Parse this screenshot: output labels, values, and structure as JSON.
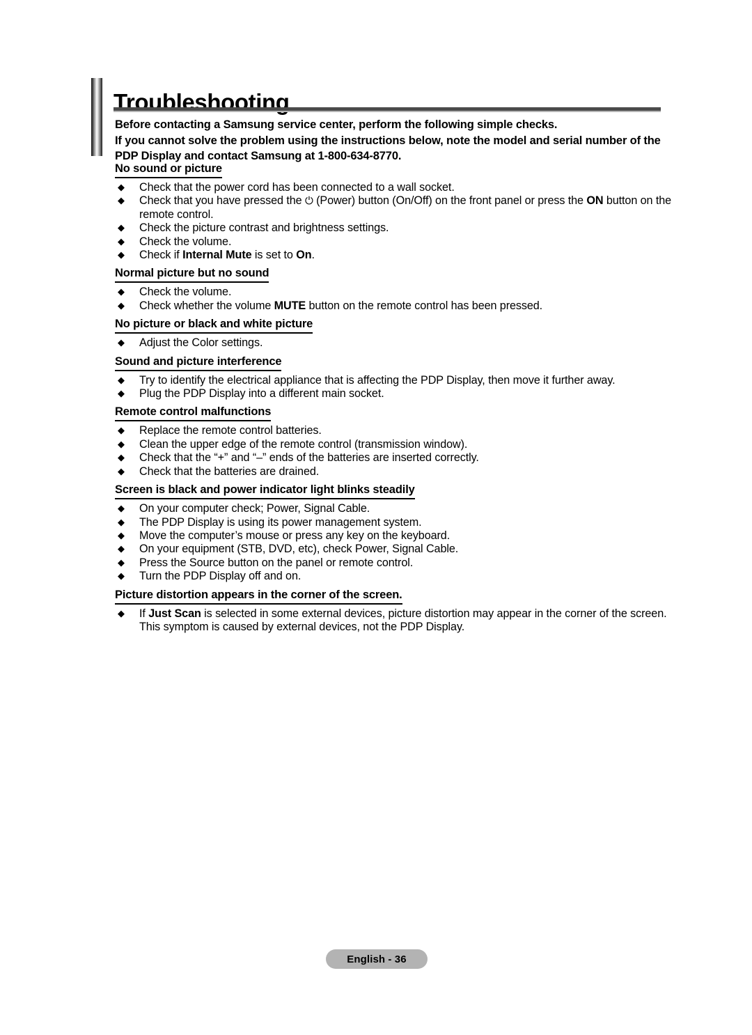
{
  "document": {
    "title": "Troubleshooting",
    "intro_lines": [
      "Before contacting a Samsung service center, perform the following simple checks.",
      "If you cannot solve the problem using the instructions below, note the model and serial number of the PDP Display and contact Samsung at 1-800-634-8770."
    ],
    "intro_full": "Before contacting a Samsung service center, perform the following simple checks. If you cannot solve the problem using the instructions below, note the model and serial number of the PDP Display and contact Samsung at 1-800-634-8770.",
    "bullet_glyph": "◆",
    "power_glyph": "⏻",
    "sections": [
      {
        "heading": "No sound or picture",
        "bullets": [
          {
            "text": "Check that the power cord has been connected to a wall socket."
          },
          {
            "text": "Check that you have pressed the ⏻ (Power) button (On/Off) on the front panel or press the ON button on the remote control.",
            "bold_parts": [
              "ON"
            ]
          },
          {
            "text": "Check the picture contrast and brightness settings."
          },
          {
            "text": "Check the volume."
          },
          {
            "text": "Check if Internal Mute is set to On.",
            "bold_parts": [
              "Internal Mute",
              "On"
            ]
          }
        ]
      },
      {
        "heading": "Normal picture but no sound",
        "bullets": [
          {
            "text": "Check the volume."
          },
          {
            "text": "Check whether the volume MUTE button on the remote control has been pressed.",
            "bold_parts": [
              "MUTE"
            ]
          }
        ]
      },
      {
        "heading": "No picture or black and white picture",
        "bullets": [
          {
            "text": "Adjust the Color settings."
          }
        ]
      },
      {
        "heading": "Sound and picture interference",
        "bullets": [
          {
            "text": "Try to identify the electrical appliance that is affecting the PDP Display, then move it further away."
          },
          {
            "text": "Plug the PDP Display into a different main socket."
          }
        ]
      },
      {
        "heading": "Remote control malfunctions",
        "bullets": [
          {
            "text": "Replace the remote control batteries."
          },
          {
            "text": "Clean the upper edge of the remote control (transmission window)."
          },
          {
            "text": "Check that the “+” and “–” ends of the batteries are inserted correctly."
          },
          {
            "text": "Check that the batteries are drained."
          }
        ]
      },
      {
        "heading": "Screen is black and power indicator light blinks steadily",
        "bullets": [
          {
            "text": "On your computer check; Power, Signal Cable."
          },
          {
            "text": "The PDP Display is using its power management system."
          },
          {
            "text": "Move the computer’s mouse or press any key on the keyboard."
          },
          {
            "text": "On your equipment (STB, DVD, etc), check Power, Signal Cable."
          },
          {
            "text": "Press the Source button on the panel or remote control."
          },
          {
            "text": "Turn the PDP Display off and on."
          }
        ]
      },
      {
        "heading": "Picture distortion appears in the corner of the screen.",
        "bullets": [
          {
            "text": "If Just Scan is selected in some external devices, picture distortion may appear in the corner of the screen. This symptom is caused by external devices, not the PDP Display.",
            "bold_parts": [
              "Just Scan"
            ]
          }
        ]
      }
    ],
    "footer": {
      "page_label": "English - 36"
    },
    "colors": {
      "text": "#000000",
      "rule_dark": "#4b4b4b",
      "rule_light": "#b6b6b6",
      "footer_pill": "#b3b3b3",
      "background": "#ffffff"
    }
  }
}
